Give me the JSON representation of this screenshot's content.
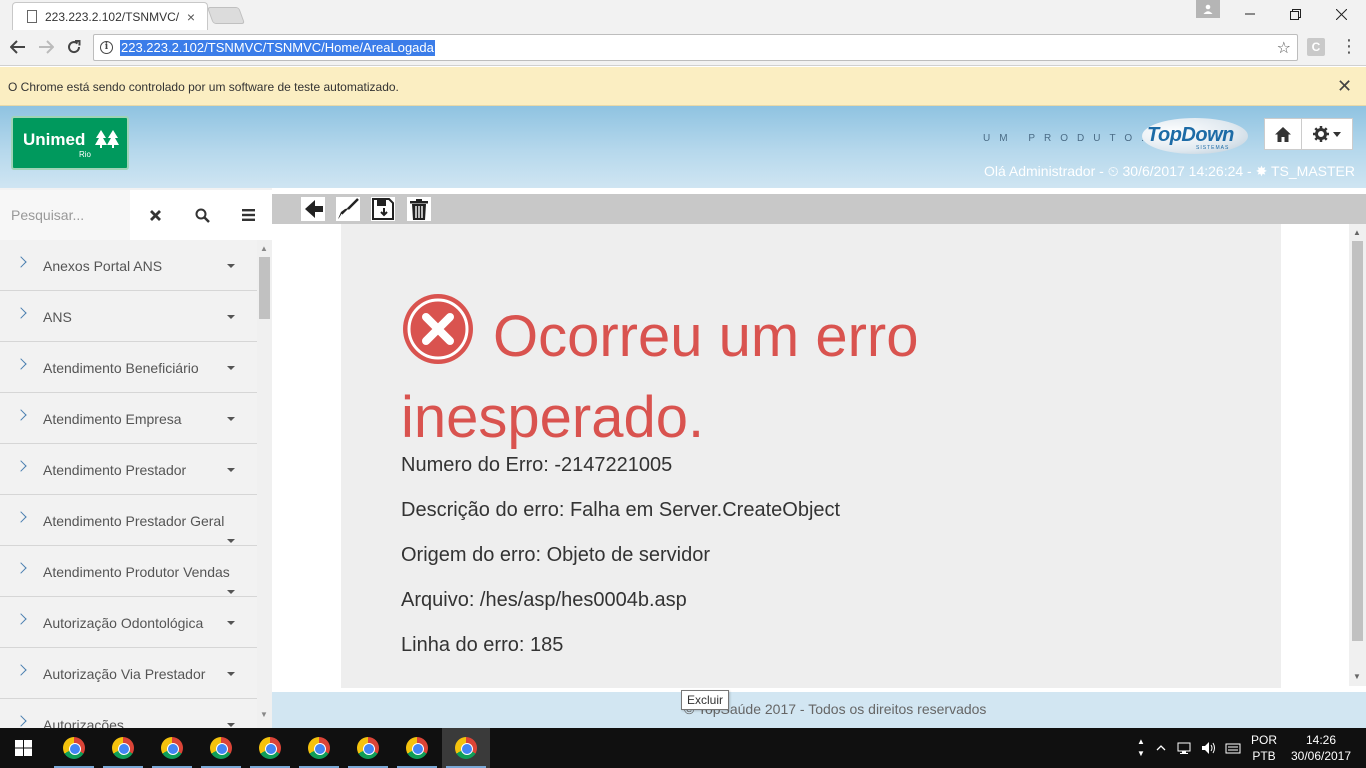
{
  "browser": {
    "tab_title": "223.223.2.102/TSNMVC/",
    "tab_close": "×",
    "url": "223.223.2.102/TSNMVC/TSNMVC/Home/AreaLogada",
    "ext_label": "C",
    "infobar_message": "O Chrome está sendo controlado por um software de teste automatizado.",
    "infobar_close": "✕"
  },
  "header": {
    "logo_text": "Unimed",
    "logo_sub": "Rio",
    "produto_label": "UM PRODUTO:",
    "topdown_text": "TopDown",
    "topdown_sub": "SISTEMAS",
    "user_line": "Olá Administrador - ⏲ 30/6/2017 14:26:24 - ✸ TS_MASTER"
  },
  "sidebar": {
    "search_placeholder": "Pesquisar...",
    "items": [
      {
        "label": "Anexos Portal ANS"
      },
      {
        "label": "ANS"
      },
      {
        "label": "Atendimento Beneficiário"
      },
      {
        "label": "Atendimento Empresa"
      },
      {
        "label": "Atendimento Prestador"
      },
      {
        "label": "Atendimento Prestador Geral"
      },
      {
        "label": "Atendimento Produtor Vendas"
      },
      {
        "label": "Autorização Odontológica"
      },
      {
        "label": "Autorização Via Prestador"
      },
      {
        "label": "Autorizações"
      }
    ]
  },
  "error": {
    "title": "Ocorreu um erro inesperado.",
    "numero": "Numero do Erro: -2147221005",
    "descricao": "Descrição do erro: Falha em Server.CreateObject",
    "origem": "Origem do erro: Objeto de servidor",
    "arquivo": "Arquivo: /hes/asp/hes0004b.asp",
    "linha": "Linha do erro: 185"
  },
  "footer": {
    "copyright": "© TopSaúde 2017 - Todos os direitos reservados"
  },
  "tooltip": "Excluir",
  "taskbar": {
    "lang_top": "POR",
    "lang_bottom": "PTB",
    "time": "14:26",
    "date": "30/06/2017"
  },
  "colors": {
    "error_red": "#d9534f",
    "unimed_green": "#00995d",
    "header_blue": "#8fc3e1"
  }
}
